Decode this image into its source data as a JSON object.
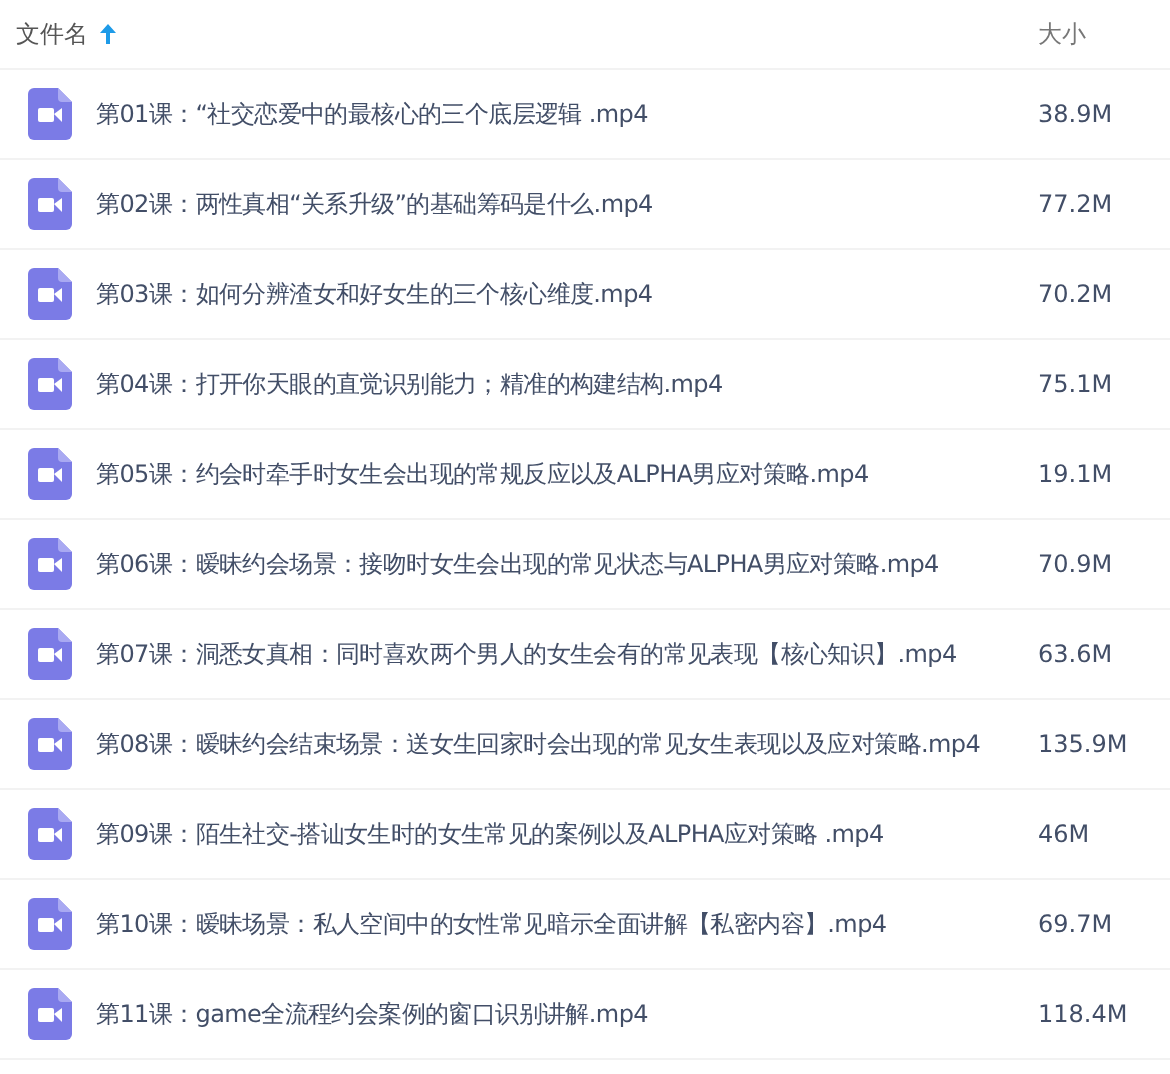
{
  "table": {
    "columns": [
      {
        "label": "文件名",
        "sorted": true
      },
      {
        "label": "大小",
        "sorted": false
      }
    ],
    "rows": [
      {
        "name": "第01课：“社交恋爱中的最核心的三个底层逻辑 .mp4",
        "size": "38.9M"
      },
      {
        "name": "第02课：两性真相“关系升级”的基础筹码是什么.mp4",
        "size": "77.2M"
      },
      {
        "name": "第03课：如何分辨渣女和好女生的三个核心维度.mp4",
        "size": "70.2M"
      },
      {
        "name": "第04课：打开你天眼的直觉识别能力；精准的构建结构.mp4",
        "size": "75.1M"
      },
      {
        "name": "第05课：约会时牵手时女生会出现的常规反应以及ALPHA男应对策略.mp4",
        "size": "19.1M"
      },
      {
        "name": "第06课：暧昧约会场景：接吻时女生会出现的常见状态与ALPHA男应对策略.mp4",
        "size": "70.9M"
      },
      {
        "name": "第07课：洞悉女真相：同时喜欢两个男人的女生会有的常见表现【核心知识】.mp4",
        "size": "63.6M"
      },
      {
        "name": "第08课：暧昧约会结束场景：送女生回家时会出现的常见女生表现以及应对策略.mp4",
        "size": "135.9M"
      },
      {
        "name": "第09课：陌生社交-搭讪女生时的女生常见的案例以及ALPHA应对策略 .mp4",
        "size": "46M"
      },
      {
        "name": "第10课：暧昧场景：私人空间中的女性常见暗示全面讲解【私密内容】.mp4",
        "size": "69.7M"
      },
      {
        "name": "第11课：game全流程约会案例的窗口识别讲解.mp4",
        "size": "118.4M"
      }
    ]
  }
}
